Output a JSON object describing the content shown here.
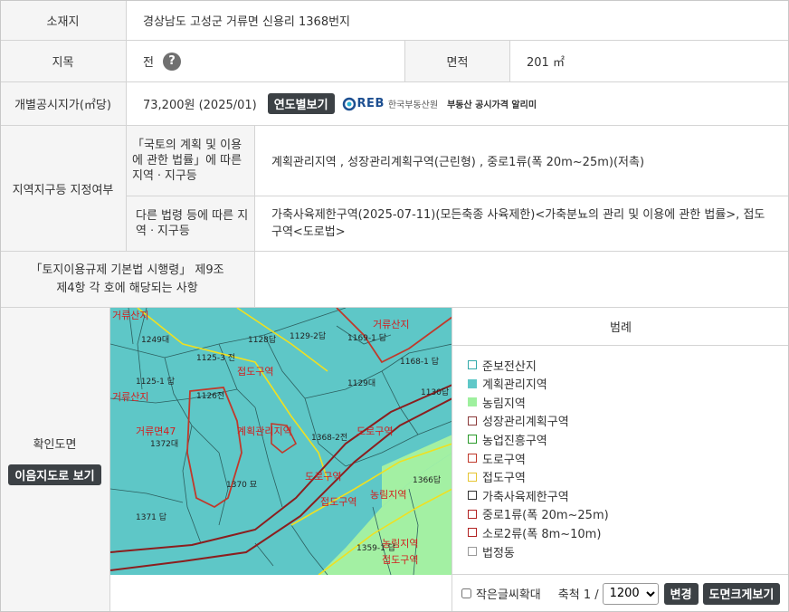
{
  "rows": {
    "location": {
      "label": "소재지",
      "value": "경상남도 고성군 거류면 신용리 1368번지"
    },
    "land_category": {
      "label": "지목",
      "value": "전",
      "help_icon": "question-mark-icon"
    },
    "area": {
      "label": "면적",
      "value": "201 ㎡"
    },
    "price": {
      "label": "개별공시지가(㎡당)",
      "value": "73,200원 (2025/01)",
      "button": "연도별보기",
      "logo_text": "한국부동산원",
      "logo_mark": "REB",
      "logo_service": "부동산 공시가격 알리미"
    },
    "zone": {
      "label": "지역지구등 지정여부",
      "national_label": "「국토의 계획 및 이용에 관한 법률」에 따른 지역ㆍ지구등",
      "national_value": "계획관리지역 , 성장관리계획구역(근린형) , 중로1류(폭 20m~25m)(저촉)",
      "other_label": "다른 법령 등에 따른 지역ㆍ지구등",
      "other_value": "가축사육제한구역(2025-07-11)(모든축종 사육제한)<가축분뇨의 관리 및 이용에 관한 법률>, 접도구역<도로법>"
    },
    "regulation": {
      "label": "「토지이용규제 기본법 시행령」 제9조 제4항 각 호에 해당되는 사항",
      "value": ""
    }
  },
  "map_section": {
    "label": "확인도면",
    "adjacent_button": "이음지도로 보기",
    "legend_title": "범례",
    "legend": [
      {
        "label": "준보전산지",
        "color": "#ffffff",
        "border": "#3aa"
      },
      {
        "label": "계획관리지역",
        "color": "#5fc8c8",
        "border": "#5fc8c8"
      },
      {
        "label": "농림지역",
        "color": "#9ef09e",
        "border": "#9ef09e"
      },
      {
        "label": "성장관리계획구역",
        "color": "#ffffff",
        "border": "#8b3a3a"
      },
      {
        "label": "농업진흥구역",
        "color": "#ffffff",
        "border": "#2a9a2a"
      },
      {
        "label": "도로구역",
        "color": "#ffffff",
        "border": "#c0392b"
      },
      {
        "label": "접도구역",
        "color": "#ffffff",
        "border": "#e6c531"
      },
      {
        "label": "가축사육제한구역",
        "color": "#ffffff",
        "border": "#333333"
      },
      {
        "label": "중로1류(폭 20m~25m)",
        "color": "#ffffff",
        "border": "#b22222"
      },
      {
        "label": "소로2류(폭 8m~10m)",
        "color": "#ffffff",
        "border": "#b22222"
      },
      {
        "label": "법정동",
        "color": "#ffffff",
        "border": "#999999"
      }
    ],
    "small_text_label": "작은글씨확대",
    "scale_label": "축척 1 /",
    "scale_value": "1200",
    "change_button": "변경",
    "large_map_button": "도면크게보기",
    "map_labels": [
      "1128답",
      "1129-2답",
      "1125-3 전",
      "1126전",
      "1125-1 답",
      "1129대",
      "1130답",
      "1368-2전",
      "1372대",
      "1370 묘",
      "1371 답",
      "1366답",
      "1359-1 답",
      "1168-1 답",
      "1249대",
      "1169-1 답"
    ],
    "map_red_labels": [
      "접도구역",
      "거류면47",
      "계획관리지역",
      "도로구역",
      "도로구역",
      "농림지역",
      "접도구역",
      "접도구역",
      "농림지역",
      "거류산지",
      "거류산지",
      "거류산지"
    ]
  }
}
